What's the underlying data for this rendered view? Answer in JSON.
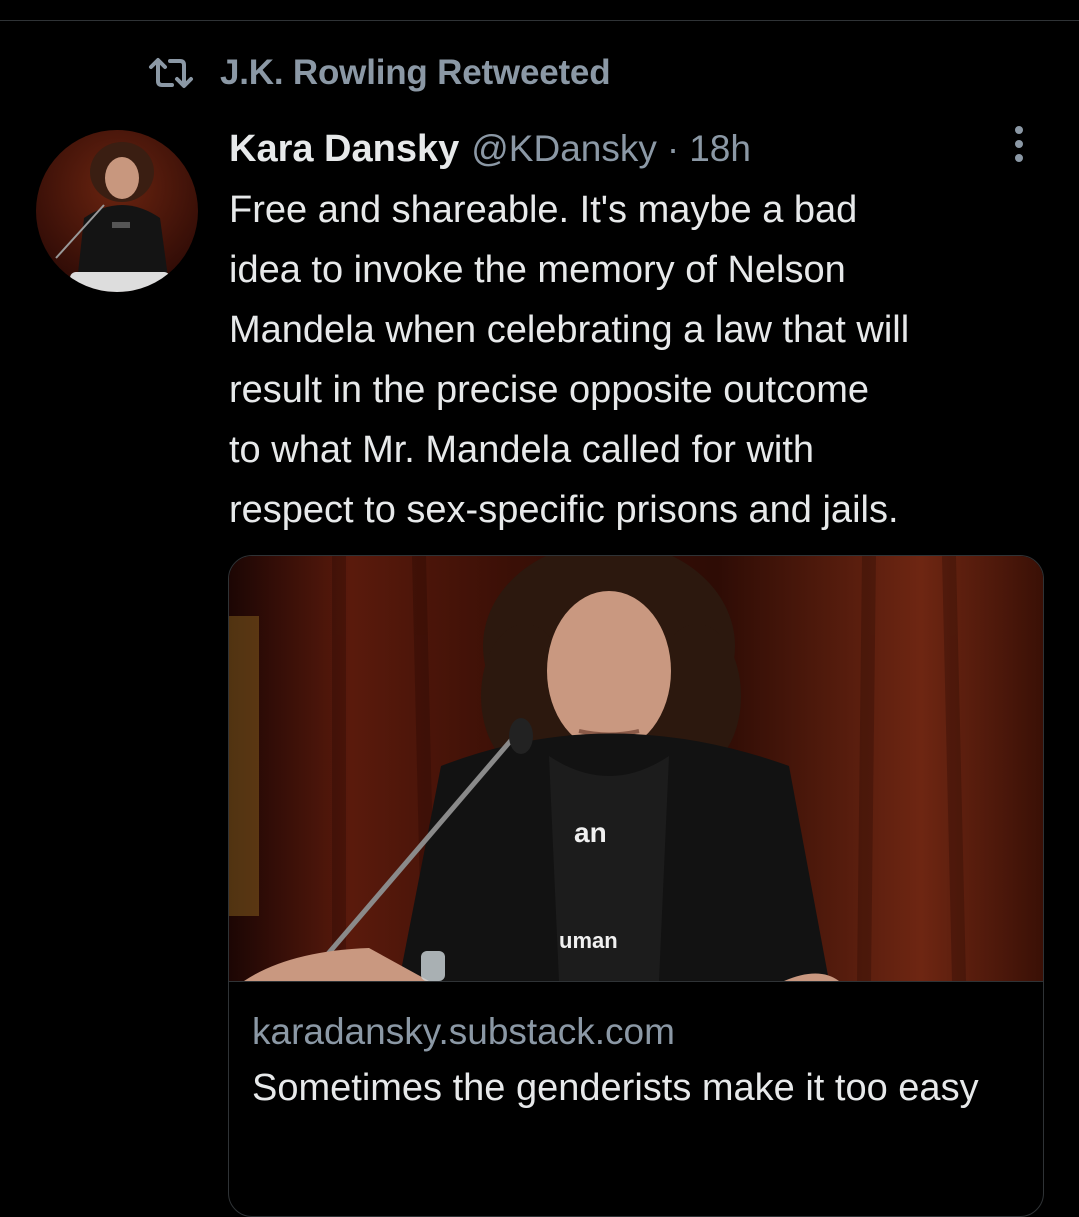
{
  "retweet": {
    "label": "J.K. Rowling Retweeted",
    "icon": "retweet-icon"
  },
  "tweet": {
    "author_name": "Kara Dansky",
    "author_handle": "@KDansky",
    "separator": "·",
    "time": "18h",
    "text": "Free and shareable. It's maybe a bad\nidea to invoke the memory of Nelson\nMandela when celebrating a law that will\nresult in the precise opposite outcome\nto what Mr. Mandela called for with\nrespect to sex-specific prisons and jails.",
    "more_icon": "more-vertical-icon"
  },
  "card": {
    "domain": "karadansky.substack.com",
    "title": "Sometimes the genderists make it too easy",
    "image_shirt_text_top": "an",
    "image_shirt_text_bottom": "uman"
  },
  "colors": {
    "background": "#000000",
    "primary_text": "#e7e9ea",
    "secondary_text": "#8b98a5",
    "border": "#2f3336"
  }
}
